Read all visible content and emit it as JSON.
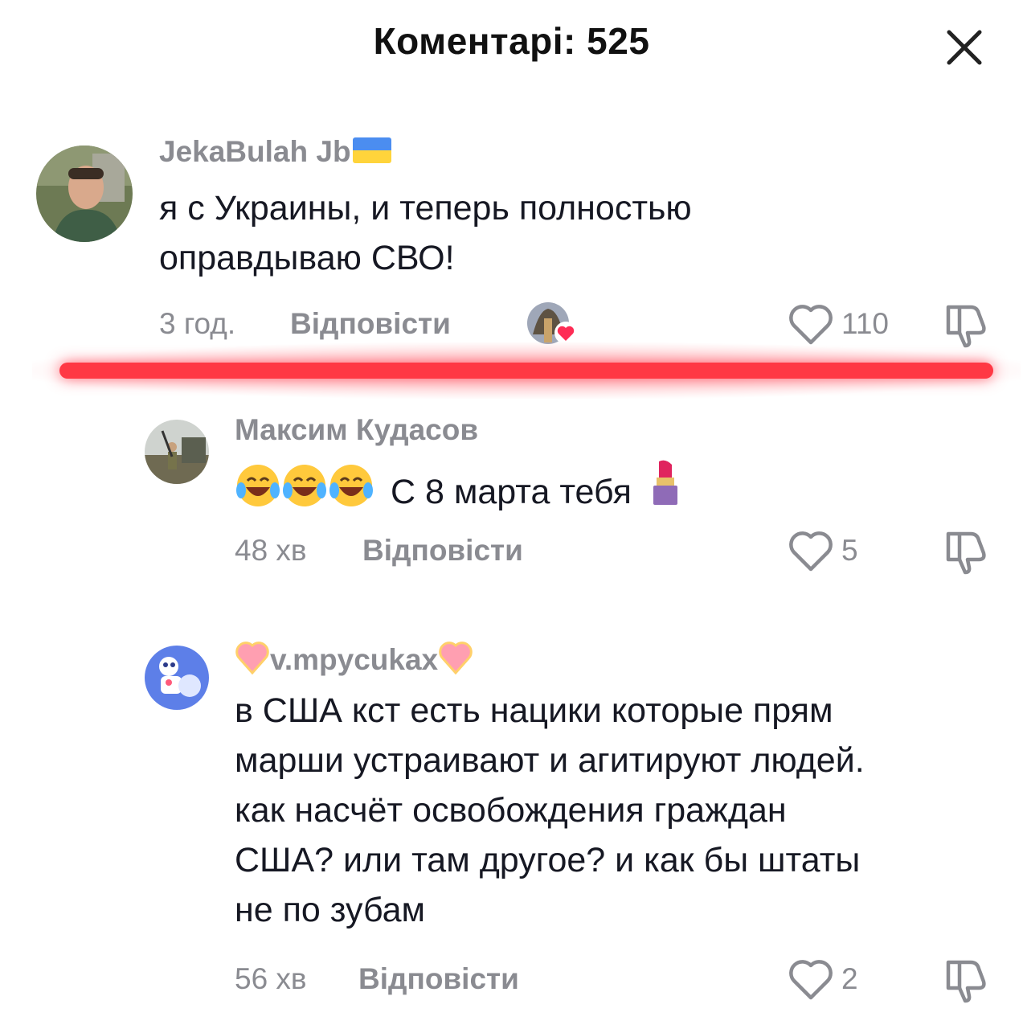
{
  "header": {
    "title": "Коментарі: 525"
  },
  "comments": [
    {
      "username": "JekaBulah Jb",
      "text_lines": [
        "я с Украины, и теперь полностью",
        "оправдываю СВО!"
      ],
      "time": "3 год.",
      "reply_label": "Відповісти",
      "likes": "110"
    },
    {
      "username": "Максим Кудасов",
      "text": "С 8 марта тебя",
      "time": "48 хв",
      "reply_label": "Відповісти",
      "likes": "5"
    },
    {
      "username": "v.mpycukax",
      "text_lines": [
        "в США кст есть нацики которые прям",
        "марши устраивают и агитируют людей.",
        "как насчёт освобождения граждан",
        "США? или там другое? и как бы штаты",
        "не по зубам"
      ],
      "time": "56 хв",
      "reply_label": "Відповісти",
      "likes": "2"
    }
  ],
  "colors": {
    "accent_red": "#ff3844",
    "muted_text": "#8a8b91",
    "primary_text": "#161823"
  }
}
